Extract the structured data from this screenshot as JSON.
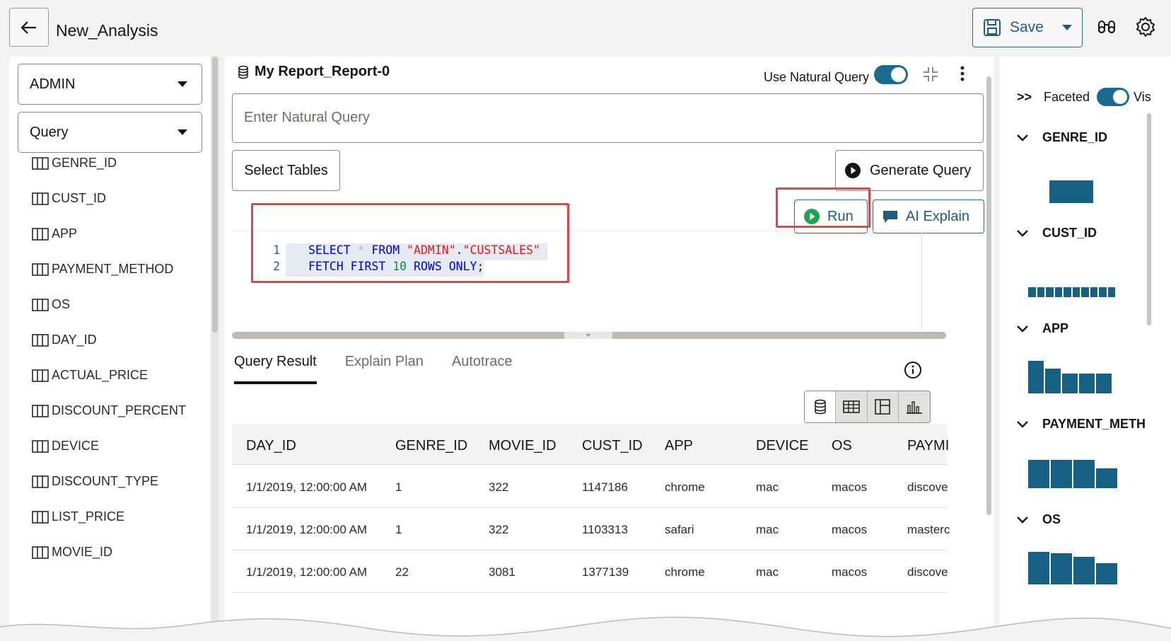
{
  "header": {
    "title": "New_Analysis",
    "save_label": "Save"
  },
  "left": {
    "schema": "ADMIN",
    "mode": "Query",
    "columns": [
      "GENRE_ID",
      "CUST_ID",
      "APP",
      "PAYMENT_METHOD",
      "OS",
      "DAY_ID",
      "ACTUAL_PRICE",
      "DISCOUNT_PERCENT",
      "DEVICE",
      "DISCOUNT_TYPE",
      "LIST_PRICE",
      "MOVIE_ID"
    ]
  },
  "report": {
    "title": "My Report_Report-0",
    "natural_query_label": "Use Natural Query",
    "natural_query_placeholder": "Enter Natural Query",
    "select_tables": "Select Tables",
    "generate_query": "Generate Query",
    "run": "Run",
    "ai_explain": "AI Explain"
  },
  "editor": {
    "line_numbers": [
      "1",
      "2"
    ],
    "line1": {
      "select": "SELECT",
      "star": "*",
      "from": "FROM",
      "schema": "\"ADMIN\"",
      "dot": ".",
      "table": "\"CUSTSALES\""
    },
    "line2": {
      "fetch": "FETCH",
      "first": "FIRST",
      "n": "10",
      "rows": "ROWS",
      "only": "ONLY",
      "semi": ";"
    }
  },
  "results": {
    "tabs": [
      "Query Result",
      "Explain Plan",
      "Autotrace"
    ],
    "active_tab": "Query Result",
    "headers": [
      "DAY_ID",
      "GENRE_ID",
      "MOVIE_ID",
      "CUST_ID",
      "APP",
      "DEVICE",
      "OS",
      "PAYMI"
    ],
    "rows": [
      [
        "1/1/2019, 12:00:00 AM",
        "1",
        "322",
        "1147186",
        "chrome",
        "mac",
        "macos",
        "discove"
      ],
      [
        "1/1/2019, 12:00:00 AM",
        "1",
        "322",
        "1103313",
        "safari",
        "mac",
        "macos",
        "masterc"
      ],
      [
        "1/1/2019, 12:00:00 AM",
        "22",
        "3081",
        "1377139",
        "chrome",
        "mac",
        "macos",
        "discove"
      ]
    ]
  },
  "facets": {
    "expand_label": ">>",
    "faceted_label": "Faceted",
    "visible_label": "Vis",
    "sections": [
      {
        "name": "GENRE_ID",
        "bars": [
          1.0
        ]
      },
      {
        "name": "CUST_ID",
        "bars": [
          1,
          1,
          1,
          1,
          1,
          1,
          1,
          1,
          1,
          1
        ]
      },
      {
        "name": "APP",
        "bars": [
          1.0,
          0.75,
          0.6,
          0.6,
          0.6
        ]
      },
      {
        "name": "PAYMENT_METH",
        "bars": [
          1.0,
          1.0,
          1.0,
          0.7
        ]
      },
      {
        "name": "OS",
        "bars": [
          1.0,
          0.95,
          0.85,
          0.65
        ]
      }
    ]
  },
  "colors": {
    "accent": "#1a6a91",
    "bar": "#166083",
    "highlight": "#e0454a"
  }
}
